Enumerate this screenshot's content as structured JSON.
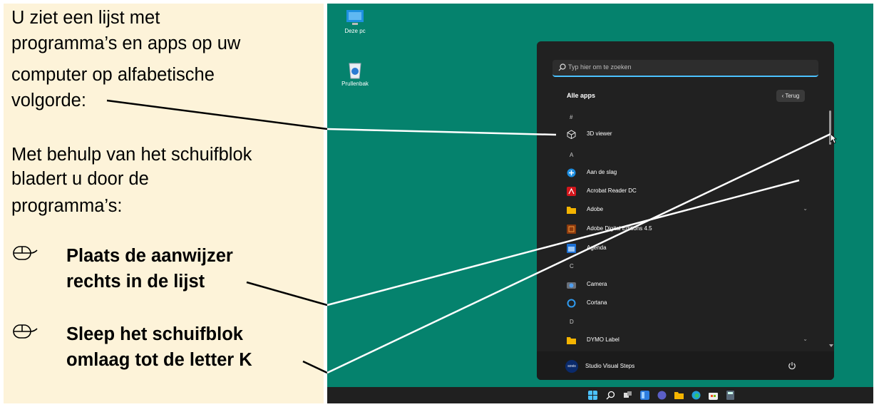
{
  "instructions": {
    "intro": [
      "U ziet een lijst met",
      "programma’s en apps op uw",
      "computer op alfabetische",
      "volgorde:"
    ],
    "scrollbar_text": [
      "Met behulp van het schuifblok",
      "bladert u door de",
      "programma’s:"
    ],
    "step1": [
      "Plaats de aanwijzer",
      "rechts in de lijst"
    ],
    "step2": [
      "Sleep het schuifblok",
      "omlaag tot de letter K"
    ]
  },
  "desktop": {
    "icons": [
      {
        "label": "Deze pc",
        "icon": "monitor-icon"
      },
      {
        "label": "Prullenbak",
        "icon": "recycle-bin-icon"
      }
    ]
  },
  "start_menu": {
    "search_placeholder": "Typ hier om te zoeken",
    "all_apps_label": "Alle apps",
    "back_label": "‹  Terug",
    "letters": [
      "#",
      "A",
      "C",
      "D"
    ],
    "apps": [
      {
        "name": "3D viewer",
        "icon": "cube-icon"
      },
      {
        "name": "Aan de slag",
        "icon": "get-started-icon"
      },
      {
        "name": "Acrobat Reader DC",
        "icon": "acrobat-icon"
      },
      {
        "name": "Adobe",
        "icon": "folder-icon"
      },
      {
        "name": "Adobe Digital Editions 4.5",
        "icon": "digital-editions-icon"
      },
      {
        "name": "Agenda",
        "icon": "calendar-icon"
      },
      {
        "name": "Camera",
        "icon": "camera-icon"
      },
      {
        "name": "Cortana",
        "icon": "cortana-icon"
      },
      {
        "name": "DYMO Label",
        "icon": "folder-icon"
      }
    ],
    "user_name": "Studio Visual Steps",
    "user_avatar_text": "sovis"
  },
  "colors": {
    "panel": "#fdf3d9",
    "desktop": "#05826d",
    "accent": "#4cc2ff"
  }
}
